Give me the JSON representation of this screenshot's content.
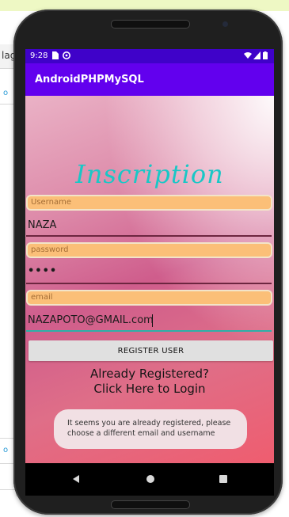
{
  "ide": {
    "tab_fragment": "lag",
    "marker_top": "o",
    "marker_bottom": "o"
  },
  "device": {
    "status_time": "9:28",
    "status_icons": [
      "sim-icon",
      "notification-icon"
    ],
    "status_right_icons": [
      "wifi-icon",
      "signal-icon",
      "battery-icon"
    ]
  },
  "app": {
    "title": "AndroidPHPMySQL"
  },
  "form": {
    "heading": "Inscription",
    "username_hint": "Username",
    "username_value": "NAZA",
    "password_hint": "password",
    "password_value": "••••",
    "email_hint": "email",
    "email_value": "NAZAPOTO@GMAIL.com",
    "register_button": "REGISTER USER",
    "login_link_line1": "Already Registered?",
    "login_link_line2": "Click Here to Login"
  },
  "toast": {
    "line1": "It seems you are already registered, please",
    "line2": "choose a different email and username"
  },
  "navigation": {
    "icons": [
      "back-icon",
      "home-icon",
      "recents-icon"
    ]
  }
}
